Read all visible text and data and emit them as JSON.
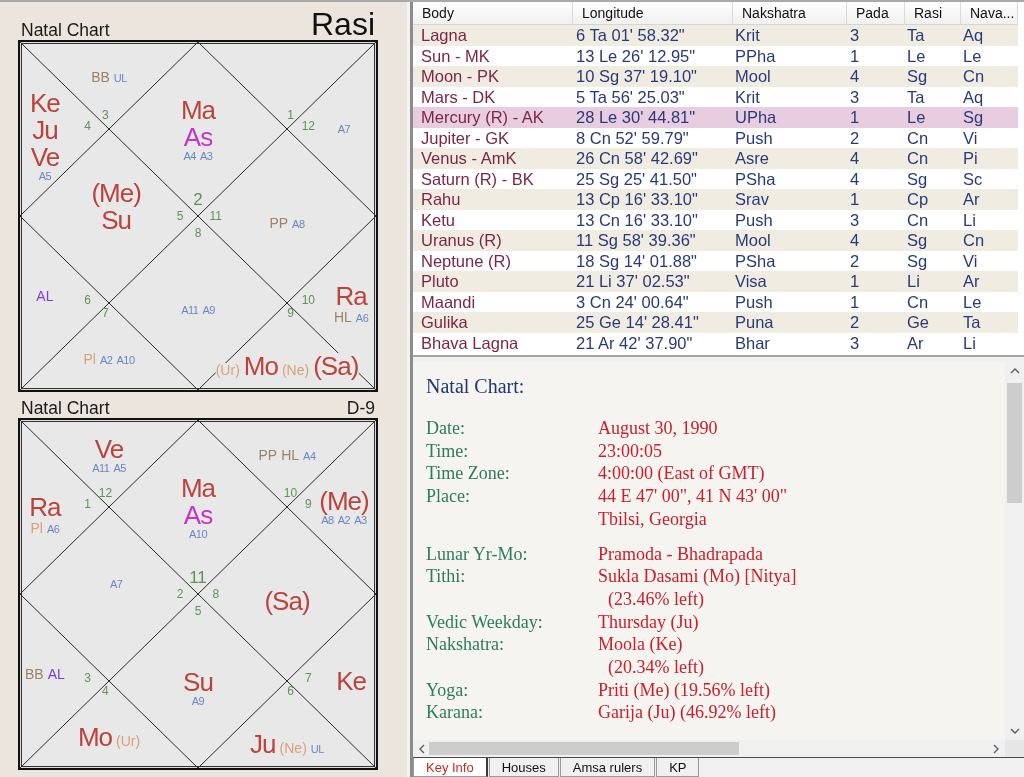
{
  "charts": [
    {
      "title": "Natal Chart",
      "name": "Rasi",
      "houses": [
        {
          "sign": "2",
          "items": [
            {
              "text": "Ma",
              "kind": "planet"
            },
            {
              "text": "As",
              "kind": "ascendant"
            },
            {
              "text": "A4",
              "kind": "arudha"
            },
            {
              "text": "A3",
              "kind": "arudha"
            }
          ]
        },
        {
          "sign": "3",
          "items": [
            {
              "text": "BB",
              "kind": "special"
            },
            {
              "text": "UL",
              "kind": "arudha"
            }
          ]
        },
        {
          "sign": "4",
          "items": [
            {
              "text": "Ke",
              "kind": "planet"
            },
            {
              "text": "Ju",
              "kind": "planet"
            },
            {
              "text": "Ve",
              "kind": "planet"
            },
            {
              "text": "A5",
              "kind": "arudha"
            }
          ]
        },
        {
          "sign": "5",
          "items": [
            {
              "text": "(Me)",
              "kind": "planet"
            },
            {
              "text": "Su",
              "kind": "planet"
            }
          ]
        },
        {
          "sign": "6",
          "items": [
            {
              "text": "AL",
              "kind": "arudha-lagna"
            }
          ]
        },
        {
          "sign": "7",
          "items": [
            {
              "text": "Pl",
              "kind": "outer"
            },
            {
              "text": "A2",
              "kind": "arudha"
            },
            {
              "text": "A10",
              "kind": "arudha"
            }
          ]
        },
        {
          "sign": "8",
          "items": [
            {
              "text": "A11",
              "kind": "arudha"
            },
            {
              "text": "A9",
              "kind": "arudha"
            }
          ]
        },
        {
          "sign": "9",
          "items": [
            {
              "text": "(Ur)",
              "kind": "outer"
            },
            {
              "text": "Mo",
              "kind": "planet"
            },
            {
              "text": "(Ne)",
              "kind": "outer"
            },
            {
              "text": "(Sa)",
              "kind": "planet"
            }
          ]
        },
        {
          "sign": "10",
          "items": [
            {
              "text": "Ra",
              "kind": "planet"
            },
            {
              "text": "HL",
              "kind": "special"
            },
            {
              "text": "A6",
              "kind": "arudha"
            }
          ]
        },
        {
          "sign": "11",
          "items": [
            {
              "text": "PP",
              "kind": "special"
            },
            {
              "text": "A8",
              "kind": "arudha"
            }
          ]
        },
        {
          "sign": "12",
          "items": [
            {
              "text": "A7",
              "kind": "arudha"
            }
          ]
        },
        {
          "sign": "1"
        }
      ]
    },
    {
      "title": "Natal Chart",
      "name": "D-9",
      "houses": [
        {
          "sign": "11",
          "items": [
            {
              "text": "Ma",
              "kind": "planet"
            },
            {
              "text": "As",
              "kind": "ascendant"
            },
            {
              "text": "A10",
              "kind": "arudha"
            }
          ]
        },
        {
          "sign": "12",
          "items": [
            {
              "text": "Ve",
              "kind": "planet"
            },
            {
              "text": "A11",
              "kind": "arudha"
            },
            {
              "text": "A5",
              "kind": "arudha"
            }
          ]
        },
        {
          "sign": "1",
          "items": [
            {
              "text": "Ra",
              "kind": "planet"
            },
            {
              "text": "Pl",
              "kind": "outer"
            },
            {
              "text": "A6",
              "kind": "arudha"
            }
          ]
        },
        {
          "sign": "2",
          "items": [
            {
              "text": "A7",
              "kind": "arudha"
            }
          ]
        },
        {
          "sign": "3",
          "items": [
            {
              "text": "BB",
              "kind": "special"
            },
            {
              "text": "AL",
              "kind": "arudha-lagna"
            }
          ]
        },
        {
          "sign": "4",
          "items": [
            {
              "text": "Mo",
              "kind": "planet"
            },
            {
              "text": "(Ur)",
              "kind": "outer"
            }
          ]
        },
        {
          "sign": "5",
          "items": [
            {
              "text": "Su",
              "kind": "planet"
            },
            {
              "text": "A9",
              "kind": "arudha"
            }
          ]
        },
        {
          "sign": "6",
          "items": [
            {
              "text": "Ju",
              "kind": "planet"
            },
            {
              "text": "(Ne)",
              "kind": "outer"
            },
            {
              "text": "UL",
              "kind": "arudha"
            }
          ]
        },
        {
          "sign": "7",
          "items": [
            {
              "text": "Ke",
              "kind": "planet"
            }
          ]
        },
        {
          "sign": "8",
          "items": [
            {
              "text": "(Sa)",
              "kind": "planet"
            }
          ]
        },
        {
          "sign": "9",
          "items": [
            {
              "text": "(Me)",
              "kind": "planet"
            },
            {
              "text": "A8",
              "kind": "arudha"
            },
            {
              "text": "A2",
              "kind": "arudha"
            },
            {
              "text": "A3",
              "kind": "arudha"
            }
          ]
        },
        {
          "sign": "10",
          "items": [
            {
              "text": "PP",
              "kind": "special"
            },
            {
              "text": "HL",
              "kind": "special"
            },
            {
              "text": "A4",
              "kind": "arudha"
            }
          ]
        }
      ]
    }
  ],
  "table": {
    "columns": [
      "Body",
      "Longitude",
      "Nakshatra",
      "Pada",
      "Rasi",
      "Nava..."
    ],
    "rows": [
      {
        "cells": [
          "Lagna",
          "6 Ta 01' 58.32\"",
          "Krit",
          "3",
          "Ta",
          "Aq"
        ],
        "selected": false
      },
      {
        "cells": [
          "Sun - MK",
          "13 Le 26' 12.95\"",
          "PPha",
          "1",
          "Le",
          "Le"
        ],
        "selected": false
      },
      {
        "cells": [
          "Moon - PK",
          "10 Sg 37' 19.10\"",
          "Mool",
          "4",
          "Sg",
          "Cn"
        ],
        "selected": false
      },
      {
        "cells": [
          "Mars - DK",
          "5 Ta 56' 25.03\"",
          "Krit",
          "3",
          "Ta",
          "Aq"
        ],
        "selected": false
      },
      {
        "cells": [
          "Mercury (R) - AK",
          "28 Le 30' 44.81\"",
          "UPha",
          "1",
          "Le",
          "Sg"
        ],
        "selected": true
      },
      {
        "cells": [
          "Jupiter - GK",
          "8 Cn 52' 59.79\"",
          "Push",
          "2",
          "Cn",
          "Vi"
        ],
        "selected": false
      },
      {
        "cells": [
          "Venus - AmK",
          "26 Cn 58' 42.69\"",
          "Asre",
          "4",
          "Cn",
          "Pi"
        ],
        "selected": false
      },
      {
        "cells": [
          "Saturn (R) - BK",
          "25 Sg 25' 41.50\"",
          "PSha",
          "4",
          "Sg",
          "Sc"
        ],
        "selected": false
      },
      {
        "cells": [
          "Rahu",
          "13 Cp 16' 33.10\"",
          "Srav",
          "1",
          "Cp",
          "Ar"
        ],
        "selected": false
      },
      {
        "cells": [
          "Ketu",
          "13 Cn 16' 33.10\"",
          "Push",
          "3",
          "Cn",
          "Li"
        ],
        "selected": false
      },
      {
        "cells": [
          "Uranus (R)",
          "11 Sg 58' 39.36\"",
          "Mool",
          "4",
          "Sg",
          "Cn"
        ],
        "selected": false
      },
      {
        "cells": [
          "Neptune (R)",
          "18 Sg 14' 01.88\"",
          "PSha",
          "2",
          "Sg",
          "Vi"
        ],
        "selected": false
      },
      {
        "cells": [
          "Pluto",
          "21 Li 37' 02.53\"",
          "Visa",
          "1",
          "Li",
          "Ar"
        ],
        "selected": false
      },
      {
        "cells": [
          "Maandi",
          "3 Cn 24' 00.64\"",
          "Push",
          "1",
          "Cn",
          "Le"
        ],
        "selected": false
      },
      {
        "cells": [
          "Gulika",
          "25 Ge 14' 28.41\"",
          "Puna",
          "2",
          "Ge",
          "Ta"
        ],
        "selected": false
      },
      {
        "cells": [
          "Bhava Lagna",
          "21 Ar 42' 37.90\"",
          "Bhar",
          "3",
          "Ar",
          "Li"
        ],
        "selected": false
      }
    ]
  },
  "info": {
    "title": "Natal Chart:",
    "sections": [
      {
        "rows": [
          {
            "label": "Date:",
            "lines": [
              "August 30, 1990"
            ]
          },
          {
            "label": "Time:",
            "lines": [
              "23:00:05"
            ]
          },
          {
            "label": "Time Zone:",
            "lines": [
              "4:00:00 (East of GMT)"
            ]
          },
          {
            "label": "Place:",
            "lines": [
              "44 E 47' 00\", 41 N 43' 00\"",
              "Tbilsi, Georgia"
            ]
          }
        ]
      },
      {
        "rows": [
          {
            "label": "Lunar Yr-Mo:",
            "lines": [
              "Pramoda - Bhadrapada"
            ]
          },
          {
            "label": "Tithi:",
            "lines": [
              "Sukla Dasami (Mo) [Nitya]"
            ],
            "remaining": "(23.46% left)"
          },
          {
            "label": "Vedic Weekday:",
            "lines": [
              "Thursday (Ju)"
            ]
          },
          {
            "label": "Nakshatra:",
            "lines": [
              "Moola (Ke)"
            ],
            "remaining": "(20.34% left)"
          },
          {
            "label": "Yoga:",
            "lines": [
              "Priti (Me) (19.56% left)"
            ]
          },
          {
            "label": "Karana:",
            "lines": [
              "Garija (Ju) (46.92% left)"
            ]
          }
        ]
      }
    ]
  },
  "tabs": [
    {
      "label": "Key Info",
      "selected": true
    },
    {
      "label": "Houses",
      "selected": false
    },
    {
      "label": "Amsa rulers",
      "selected": false
    },
    {
      "label": "KP",
      "selected": false
    }
  ]
}
